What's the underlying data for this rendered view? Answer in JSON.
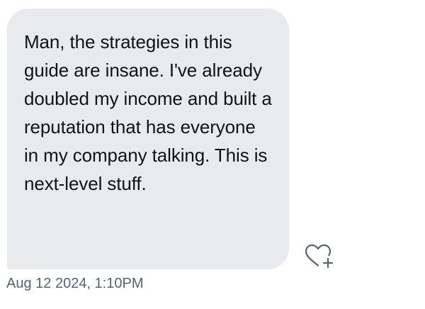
{
  "message": {
    "text": "Man, the strategies in this guide are insane. I've already doubled my income and built a reputation that has everyone in my company talking. This is next-level stuff.",
    "timestamp": "Aug 12 2024, 1:10PM"
  },
  "icons": {
    "reaction": "heart-plus-icon"
  },
  "colors": {
    "bubble_background": "#e8eaee",
    "message_text": "#0f1419",
    "timestamp_text": "#536471",
    "icon_stroke": "#536471"
  }
}
